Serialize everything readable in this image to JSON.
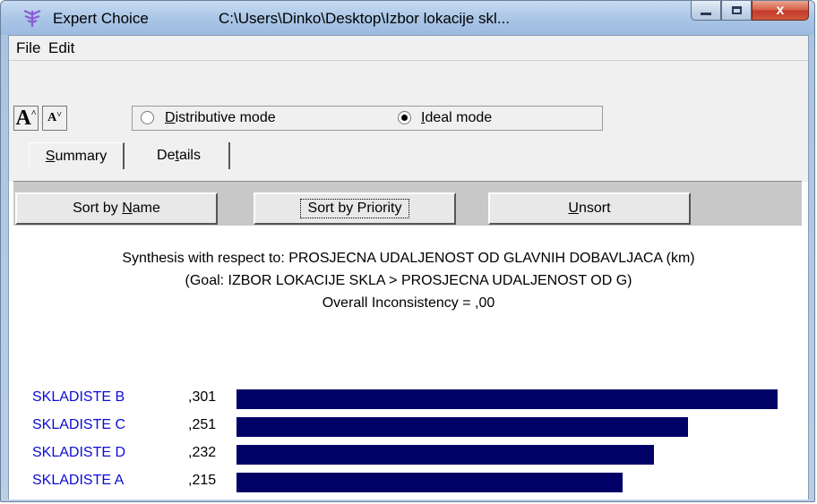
{
  "window": {
    "app_name": "Expert Choice",
    "path": "C:\\Users\\Dinko\\Desktop\\Izbor lokacije skl...",
    "close_glyph": "x"
  },
  "menu": {
    "file": "File",
    "edit": "Edit"
  },
  "toolbar": {
    "font_up": "A",
    "font_down": "A",
    "distributive_label": "Distributive mode",
    "ideal_label": "Ideal mode",
    "selected_mode": "ideal"
  },
  "tabs": {
    "summary": "Summary",
    "details": "Details"
  },
  "buttons": {
    "sort_name": "Sort by Name",
    "sort_priority": "Sort by Priority",
    "unsort": "Unsort"
  },
  "synthesis": {
    "line1": "Synthesis with respect to: PROSJECNA UDALJENOST OD GLAVNIH DOBAVLJACA (km)",
    "line2": "(Goal: IZBOR LOKACIJE SKLA > PROSJECNA UDALJENOST OD G)",
    "line3": "Overall Inconsistency = ,00"
  },
  "colors": {
    "bar": "#000066",
    "name_text": "#0b0bd6"
  },
  "chart_data": {
    "type": "bar",
    "categories": [
      "SKLADISTE B",
      "SKLADISTE C",
      "SKLADISTE D",
      "SKLADISTE A"
    ],
    "value_labels": [
      ",301",
      ",251",
      ",232",
      ",215"
    ],
    "values": [
      0.301,
      0.251,
      0.232,
      0.215
    ]
  }
}
